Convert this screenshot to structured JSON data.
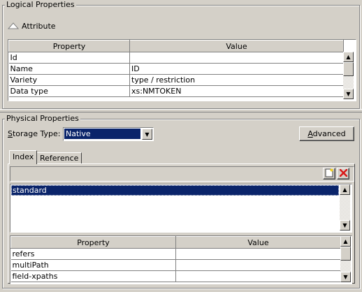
{
  "logical": {
    "title": "Logical Properties",
    "attribute_label": "Attribute",
    "columns": [
      "Property",
      "Value"
    ],
    "rows": [
      {
        "property": "Id",
        "value": ""
      },
      {
        "property": "Name",
        "value": "ID"
      },
      {
        "property": "Variety",
        "value": "type / restriction"
      },
      {
        "property": "Data type",
        "value": "xs:NMTOKEN"
      }
    ]
  },
  "physical": {
    "title": "Physical Properties",
    "storage_label_prefix": "",
    "storage_label_mnemonic": "S",
    "storage_label_rest": "torage Type:",
    "storage_value": "Native",
    "advanced_mnemonic": "A",
    "advanced_rest": "dvanced",
    "tabs": [
      "Index",
      "Reference"
    ],
    "index_list": [
      "standard"
    ],
    "columns": [
      "Property",
      "Value"
    ],
    "rows": [
      {
        "property": "refers",
        "value": ""
      },
      {
        "property": "multiPath",
        "value": ""
      },
      {
        "property": "field-xpaths",
        "value": ""
      }
    ]
  },
  "colors": {
    "background": "#d4d0c8",
    "selection": "#0a246a",
    "delete_icon": "#d81818"
  }
}
